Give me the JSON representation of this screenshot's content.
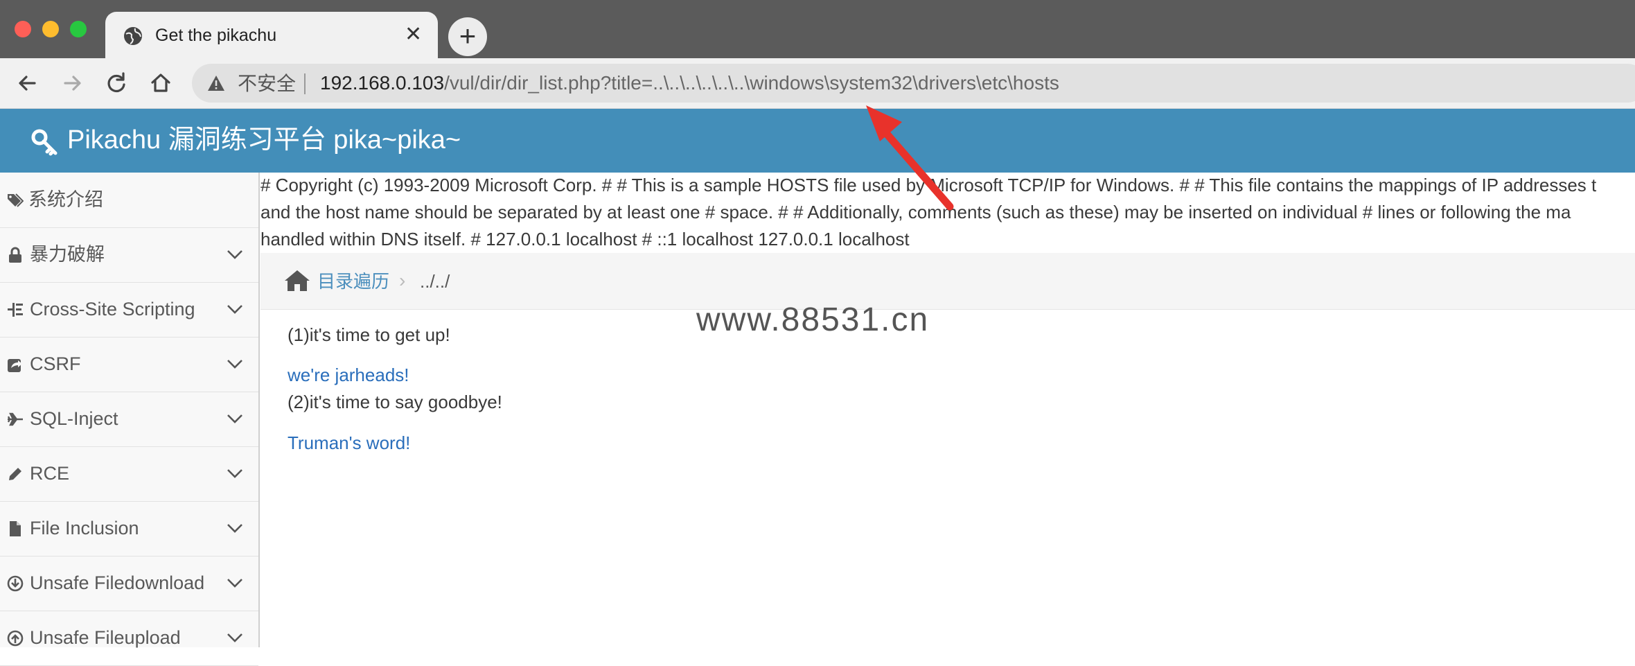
{
  "browser": {
    "tab": {
      "title": "Get the pikachu",
      "icon": "globe-icon"
    },
    "new_tab_label": "+",
    "address_bar": {
      "security_label": "不安全",
      "url_host": "192.168.0.103",
      "url_path": "/vul/dir/dir_list.php?title=..\\..\\..\\..\\..\\..\\windows\\system32\\drivers\\etc\\hosts"
    }
  },
  "page": {
    "header_title": "Pikachu 漏洞练习平台 pika~pika~",
    "sidebar": [
      {
        "label": "系统介绍",
        "icon": "tags-icon",
        "has_chevron": false
      },
      {
        "label": "暴力破解",
        "icon": "lock-icon",
        "has_chevron": true
      },
      {
        "label": "Cross-Site Scripting",
        "icon": "list-tree-icon",
        "has_chevron": true
      },
      {
        "label": "CSRF",
        "icon": "share-square-icon",
        "has_chevron": true
      },
      {
        "label": "SQL-Inject",
        "icon": "plane-icon",
        "has_chevron": true
      },
      {
        "label": "RCE",
        "icon": "pencil-icon",
        "has_chevron": true
      },
      {
        "label": "File Inclusion",
        "icon": "file-icon",
        "has_chevron": true
      },
      {
        "label": "Unsafe Filedownload",
        "icon": "download-circle-icon",
        "has_chevron": true
      },
      {
        "label": "Unsafe Fileupload",
        "icon": "upload-circle-icon",
        "has_chevron": true
      }
    ],
    "hosts_output": [
      "# Copyright (c) 1993-2009 Microsoft Corp. # # This is a sample HOSTS file used by Microsoft TCP/IP for Windows. # # This file contains the mappings of IP addresses t",
      "and the host name should be separated by at least one # space. # # Additionally, comments (such as these) may be inserted on individual # lines or following the ma",
      "handled within DNS itself. # 127.0.0.1 localhost # ::1 localhost 127.0.0.1 localhost"
    ],
    "breadcrumb": {
      "link": "目录遍历",
      "separator": "›",
      "current": "../../"
    },
    "content": {
      "line1": "(1)it's time to get up!",
      "link1": "we're jarheads!",
      "line2": "(2)it's time to say goodbye!",
      "link2": "Truman's word!"
    },
    "watermark": "www.88531.cn"
  },
  "colors": {
    "header_bg": "#438eb9",
    "link": "#2a6ebb",
    "annotation_arrow": "#e8322b"
  }
}
